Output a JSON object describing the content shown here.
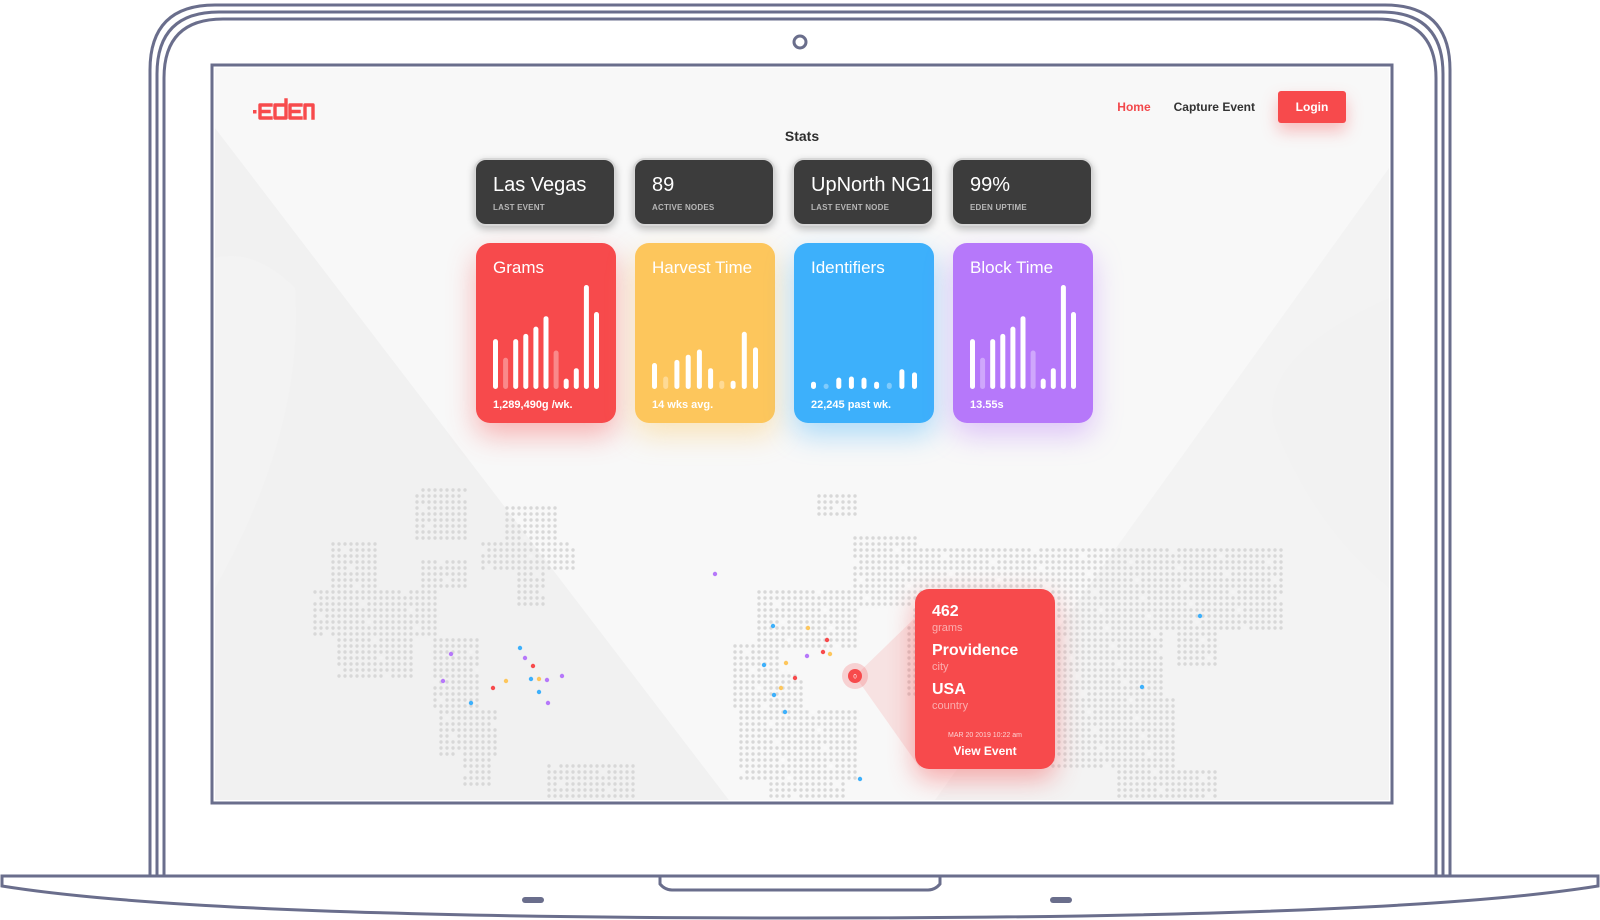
{
  "app": {
    "logo_text": "eden"
  },
  "nav": {
    "items": [
      {
        "label": "Home",
        "active": true
      },
      {
        "label": "Capture Event",
        "active": false
      }
    ],
    "login_label": "Login"
  },
  "stats": {
    "title": "Stats",
    "cards": [
      {
        "value": "Las Vegas",
        "label": "LAST EVENT"
      },
      {
        "value": "89",
        "label": "ACTIVE NODES"
      },
      {
        "value": "UpNorth NG1",
        "label": "LAST EVENT NODE"
      },
      {
        "value": "99%",
        "label": "EDEN UPTIME"
      }
    ]
  },
  "metrics": [
    {
      "title": "Grams",
      "subtitle": "1,289,490g /wk.",
      "color": "#f74a4c",
      "bars": [
        0.48,
        0.3,
        0.48,
        0.53,
        0.6,
        0.7,
        0.37,
        0.1,
        0.2,
        1.0,
        0.74
      ],
      "faded": [
        false,
        true,
        false,
        false,
        false,
        false,
        true,
        false,
        false,
        false,
        false
      ]
    },
    {
      "title": "Harvest Time",
      "subtitle": "14 wks avg.",
      "color": "#fdc65c",
      "bars": [
        0.25,
        0.12,
        0.28,
        0.33,
        0.38,
        0.2,
        0.08,
        0.08,
        0.55,
        0.4
      ],
      "faded": [
        false,
        true,
        false,
        false,
        false,
        false,
        true,
        false,
        false,
        false
      ]
    },
    {
      "title": "Identifiers",
      "subtitle": "22,245 past wk.",
      "color": "#3db0fb",
      "bars": [
        0.07,
        0.05,
        0.11,
        0.12,
        0.11,
        0.07,
        0.06,
        0.19,
        0.16
      ],
      "faded": [
        false,
        true,
        false,
        false,
        false,
        false,
        true,
        false,
        false
      ]
    },
    {
      "title": "Block Time",
      "subtitle": "13.55s",
      "color": "#b678fa",
      "bars": [
        0.48,
        0.3,
        0.48,
        0.53,
        0.6,
        0.7,
        0.37,
        0.1,
        0.2,
        1.0,
        0.74
      ],
      "faded": [
        false,
        true,
        false,
        false,
        false,
        false,
        true,
        false,
        false,
        false,
        false
      ]
    }
  ],
  "event": {
    "grams_value": "462",
    "grams_label": "grams",
    "city_value": "Providence",
    "city_label": "city",
    "country_value": "USA",
    "country_label": "country",
    "date": "MAR 20 2019 10:22 am",
    "action_label": "View Event"
  },
  "marker_label": "0",
  "colors": {
    "accent": "#f74a4c",
    "dark_card": "#3c3c3c",
    "frame": "#6a6e8c",
    "map_dot": "#d8d8d8",
    "nav_active": "#f2484b"
  },
  "event_dots": {
    "colors": [
      "#f74a4c",
      "#b678fa",
      "#3db0fb",
      "#fdc65c"
    ]
  }
}
